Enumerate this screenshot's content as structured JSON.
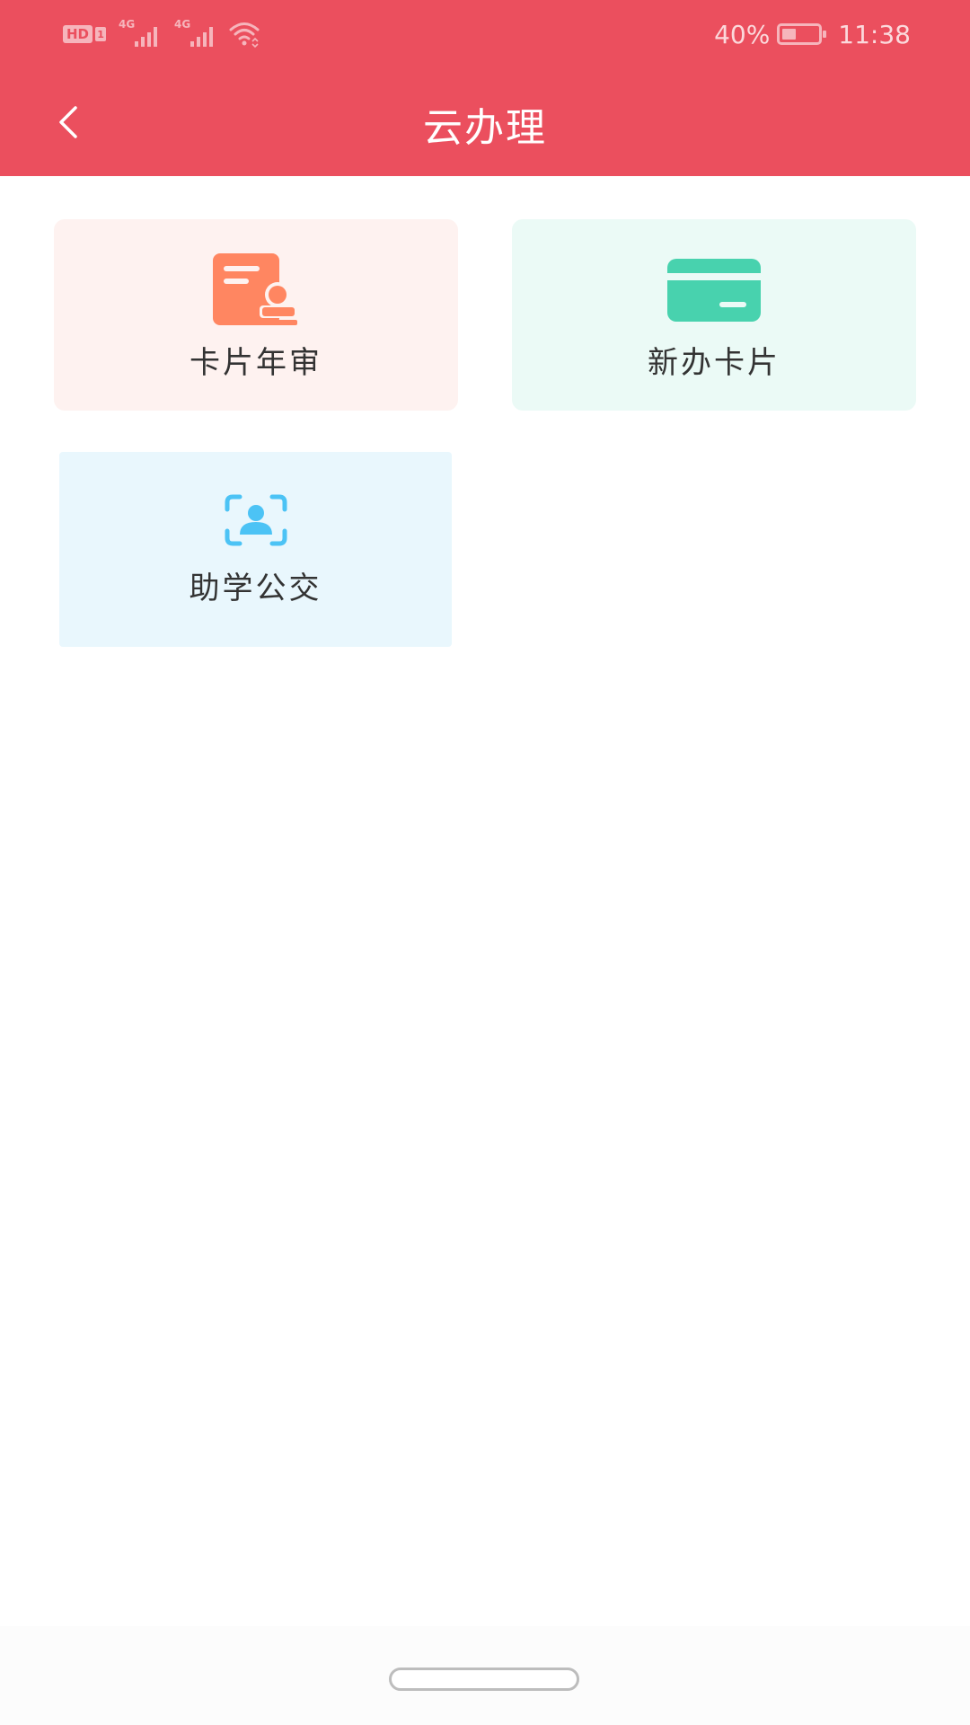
{
  "status_bar": {
    "hd_label": "HD",
    "sim_label": "1",
    "network_1": "4G",
    "network_2": "4G",
    "battery_percent": "40%",
    "battery_level": 0.4,
    "time": "11:38"
  },
  "nav": {
    "title": "云办理"
  },
  "tiles": [
    {
      "label": "卡片年审",
      "icon": "certificate-stamp-icon",
      "bg": "#FEF2F0",
      "accent": "#FF8661"
    },
    {
      "label": "新办卡片",
      "icon": "credit-card-icon",
      "bg": "#EBFAF6",
      "accent": "#48D2AE"
    },
    {
      "label": "助学公交",
      "icon": "face-scan-icon",
      "bg": "#E9F7FD",
      "accent": "#4CC3F5"
    }
  ],
  "colors": {
    "header": "#EB4F5E"
  }
}
